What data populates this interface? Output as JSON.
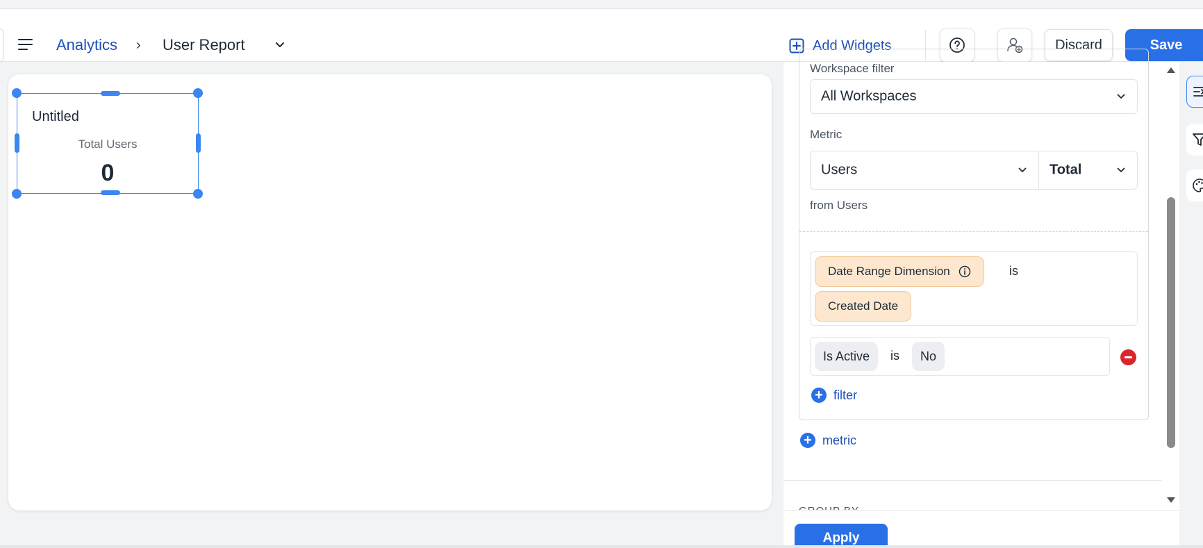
{
  "header": {
    "breadcrumb_root": "Analytics",
    "breadcrumb_sep": "›",
    "report_title": "User Report",
    "add_widgets_label": "Add Widgets",
    "discard_label": "Discard",
    "save_label": "Save"
  },
  "widget": {
    "title": "Untitled",
    "metric_label": "Total Users",
    "value": "0"
  },
  "panel": {
    "workspace_filter_label": "Workspace filter",
    "workspace_filter_value": "All Workspaces",
    "metric_label": "Metric",
    "metric_field": "Users",
    "metric_aggregation": "Total",
    "from_text": "from Users",
    "date_filter": {
      "dimension_label": "Date Range Dimension",
      "operator": "is",
      "value": "Created Date"
    },
    "active_filter": {
      "field": "Is Active",
      "operator": "is",
      "value": "No"
    },
    "add_filter_label": "filter",
    "add_metric_label": "metric",
    "group_by_label": "GROUP BY",
    "apply_label": "Apply"
  },
  "colors": {
    "accent": "#2970e6",
    "link": "#1d4fb8",
    "selection": "#3b86f0",
    "chip_orange": "#fde8cf",
    "danger": "#d9262c"
  },
  "icons": {
    "menu": "hamburger-menu-icon",
    "add": "plus-square-icon",
    "help": "question-circle-icon",
    "share": "user-add-icon",
    "info": "info-circle-icon",
    "remove": "minus-circle-icon",
    "rail": [
      "settings-panel-icon",
      "filter-funnel-icon",
      "palette-icon"
    ]
  }
}
